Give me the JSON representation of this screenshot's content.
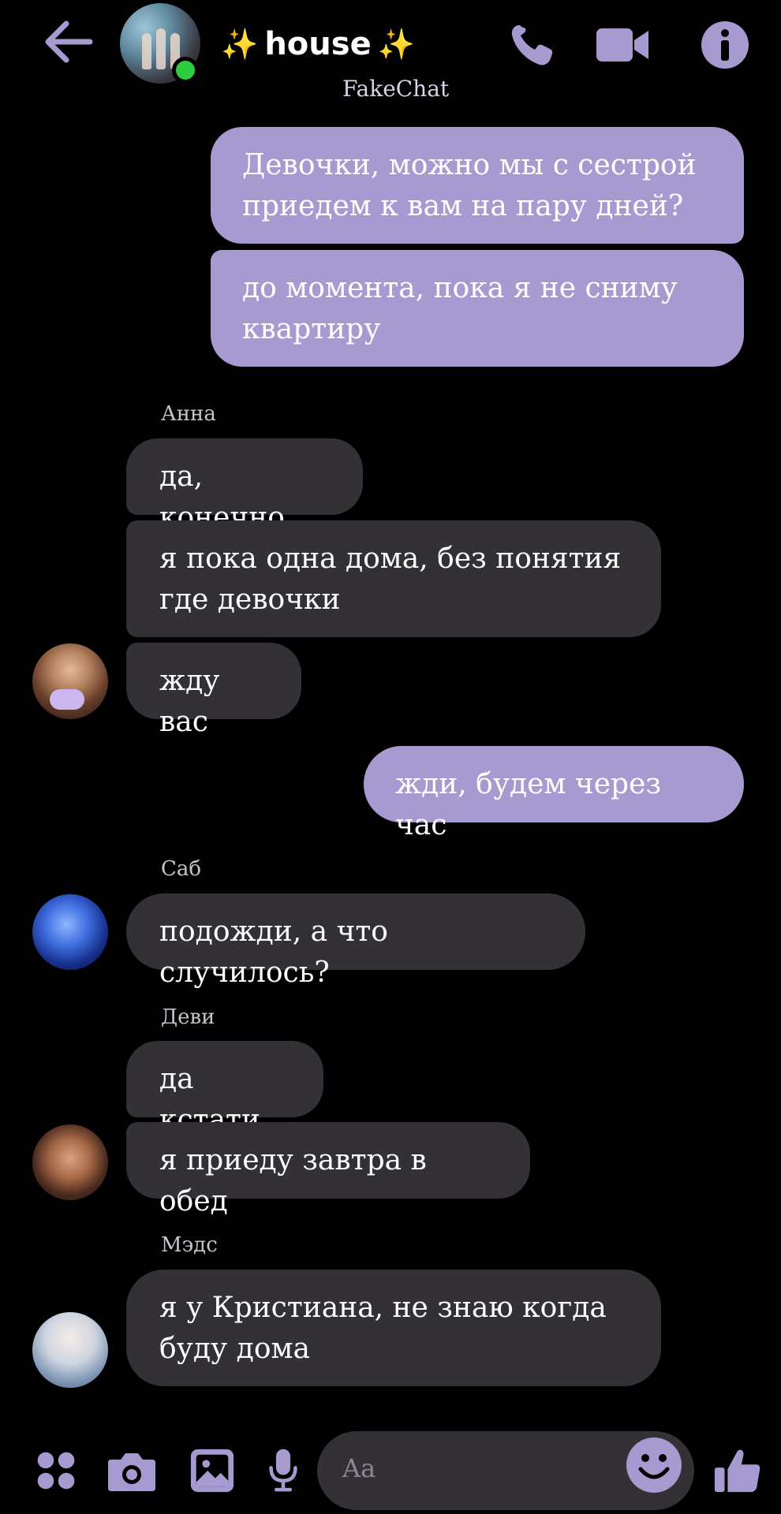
{
  "header": {
    "title": "house",
    "sparkle": "✨",
    "subtitle": "FakeChat",
    "icons": [
      "back-arrow-icon",
      "phone-icon",
      "video-camera-icon",
      "info-icon"
    ]
  },
  "messages": [
    {
      "id": "m1",
      "dir": "out",
      "text": "Девочки, можно мы с сестрой приедем к вам на пару дней?"
    },
    {
      "id": "m2",
      "dir": "out",
      "text": "до момента, пока я не сниму квартиру"
    },
    {
      "id": "s1",
      "type": "sender",
      "text": "Анна"
    },
    {
      "id": "m3",
      "dir": "in",
      "text": "да, конечно"
    },
    {
      "id": "m4",
      "dir": "in",
      "text": "я пока одна дома, без понятия где девочки"
    },
    {
      "id": "m5",
      "dir": "in",
      "text": "жду вас"
    },
    {
      "id": "m6",
      "dir": "out",
      "text": "жди, будем через час"
    },
    {
      "id": "s2",
      "type": "sender",
      "text": "Саб"
    },
    {
      "id": "m7",
      "dir": "in",
      "text": "подожди, а что случилось?"
    },
    {
      "id": "s3",
      "type": "sender",
      "text": "Деви"
    },
    {
      "id": "m8",
      "dir": "in",
      "text": "да кстати"
    },
    {
      "id": "m9",
      "dir": "in",
      "text": "я приеду завтра в обед"
    },
    {
      "id": "s4",
      "type": "sender",
      "text": "Мэдс"
    },
    {
      "id": "m10",
      "dir": "in",
      "text": "я у Кристиана, не знаю когда буду дома"
    }
  ],
  "composer": {
    "placeholder": "Aa",
    "icons": [
      "apps-grid-icon",
      "camera-icon",
      "gallery-icon",
      "microphone-icon",
      "emoji-icon",
      "thumbs-up-icon"
    ]
  },
  "colors": {
    "accent": "#a69ad0",
    "incoming_bubble": "#333135",
    "background": "#000000",
    "online": "#2ecc40"
  }
}
